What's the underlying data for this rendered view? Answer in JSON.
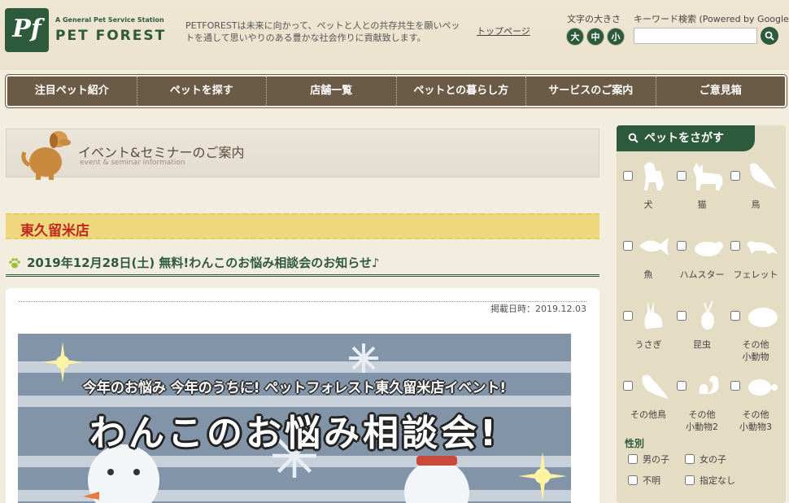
{
  "header": {
    "logo_tag": "A General Pet Service Station",
    "logo_name": "PET FOREST",
    "logo_mark": "Pf",
    "tagline": "PETFORESTは未来に向かって、ペットと人との共存共生を願いペットを通して思いやりのある豊かな社会作りに貢献致します。",
    "top_link": "トップページ",
    "fontsize_label": "文字の大きさ",
    "fontsize_buttons": [
      "大",
      "中",
      "小"
    ],
    "search_label": "キーワード検索 (Powered by Google)",
    "search_value": ""
  },
  "nav": {
    "items": [
      "注目ペット紹介",
      "ペットを探す",
      "店舗一覧",
      "ペットとの暮らし方",
      "サービスのご案内",
      "ご意見箱"
    ]
  },
  "main": {
    "page_title": "イベント&セミナーのご案内",
    "page_subtitle": "event & seminar information",
    "store_name": "東久留米店",
    "event_title": "2019年12月28日(土) 無料!わんこのお悩み相談会のお知らせ♪",
    "posted": "掲載日時：2019.12.03",
    "banner_sub": "今年のお悩み 今年のうちに! ペットフォレスト東久留米店イベント!",
    "banner_main": "わんこのお悩み相談会!"
  },
  "sidebar": {
    "heading": "ペットをさがす",
    "pets": [
      {
        "label": "犬",
        "icon": "dog-icon"
      },
      {
        "label": "猫",
        "icon": "cat-icon"
      },
      {
        "label": "鳥",
        "icon": "bird-icon"
      },
      {
        "label": "魚",
        "icon": "fish-icon"
      },
      {
        "label": "ハムスター",
        "icon": "hamster-icon"
      },
      {
        "label": "フェレット",
        "icon": "ferret-icon"
      },
      {
        "label": "うさぎ",
        "icon": "rabbit-icon"
      },
      {
        "label": "昆虫",
        "icon": "beetle-icon"
      },
      {
        "label": "その他\n小動物",
        "icon": "small-animal-icon"
      },
      {
        "label": "その他鳥",
        "icon": "other-bird-icon"
      },
      {
        "label": "その他\n小動物2",
        "icon": "squirrel-icon"
      },
      {
        "label": "その他\n小動物3",
        "icon": "turtle-icon"
      }
    ],
    "gender_title": "性別",
    "gender_options": [
      "男の子",
      "女の子",
      "不明",
      "指定なし"
    ]
  },
  "colors": {
    "brand_green": "#2d5a3a",
    "nav_brown": "#6b5a45",
    "store_red": "#c0281e",
    "store_yellow": "#efd77d"
  }
}
